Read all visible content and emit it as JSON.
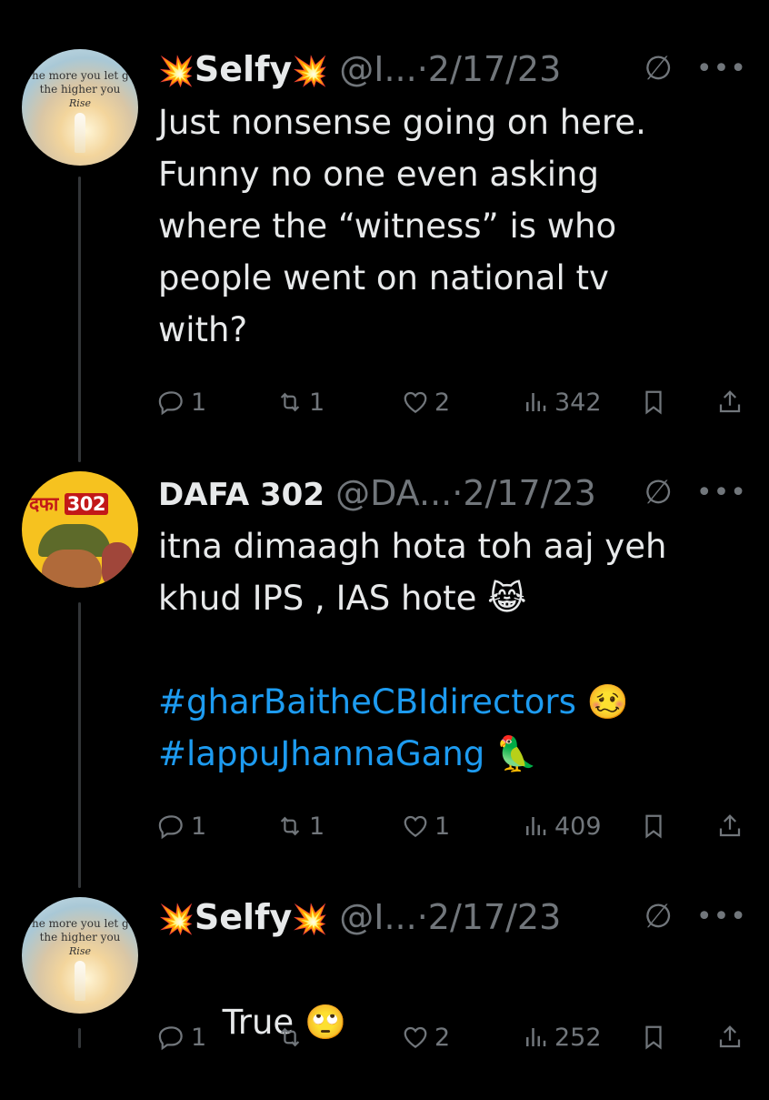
{
  "tweets": [
    {
      "author_name": "Selfy",
      "name_decoration": "💥",
      "handle": "@I...",
      "separator": "·",
      "date": "2/17/23",
      "avatar": {
        "motto_line1": "The more you let go",
        "motto_line2": "the higher you",
        "motto_line3": "Rise"
      },
      "text": "Just nonsense going on here. Funny no one even asking where the “witness” is who people went on national tv with?",
      "replies": "1",
      "reposts": "1",
      "likes": "2",
      "views": "342"
    },
    {
      "author_name": "DAFA 302",
      "handle": "@DA...",
      "separator": "·",
      "date": "2/17/23",
      "avatar": {
        "logo_text": "दफा",
        "logo_number": "302"
      },
      "text_line1": "itna dimaagh hota toh aaj yeh",
      "text_line2": "khud IPS , IAS hote",
      "hashtag1": "#gharBaitheCBIdirectors",
      "hashtag2": "#lappuJhannaGang",
      "emoji_crying_cat": "😹",
      "emoji_woozy": "🥴",
      "emoji_parrot": "🦜",
      "replies": "1",
      "reposts": "1",
      "likes": "1",
      "views": "409"
    },
    {
      "author_name": "Selfy",
      "name_decoration": "💥",
      "handle": "@I...",
      "separator": "·",
      "date": "2/17/23",
      "avatar": {
        "motto_line1": "The more you let go",
        "motto_line2": "the higher you",
        "motto_line3": "Rise"
      },
      "text": "True",
      "emoji_eyeroll": "🙄",
      "replies": "1",
      "reposts": "",
      "likes": "2",
      "views": "252"
    }
  ],
  "colors": {
    "background": "#000000",
    "text": "#e7e9ea",
    "secondary": "#71767b",
    "link": "#1d9bf0",
    "thread_line": "#333639"
  },
  "icons": [
    "reply-icon",
    "repost-icon",
    "like-icon",
    "views-icon",
    "bookmark-icon",
    "share-icon",
    "grok-icon",
    "more-icon"
  ]
}
